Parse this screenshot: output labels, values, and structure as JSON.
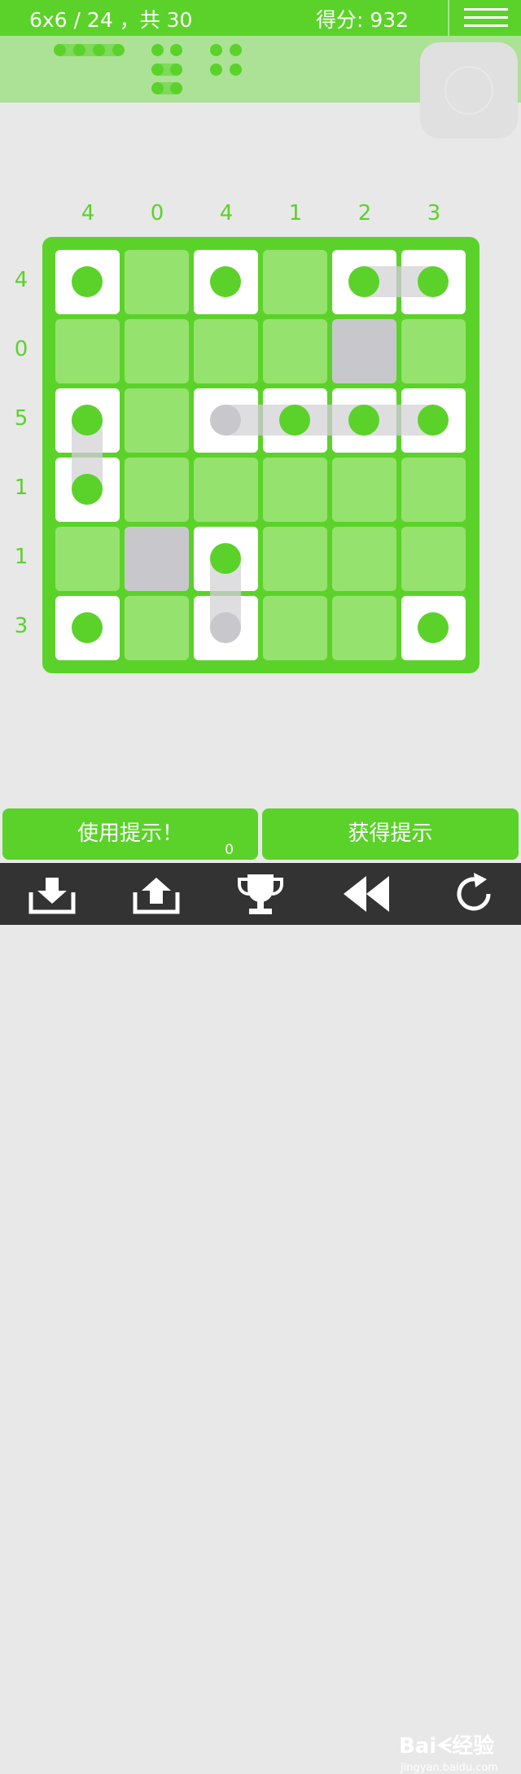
{
  "header": {
    "level_progress": "6x6 / 24 ，共 30",
    "score": "得分: 932",
    "menu_icon": "hamburger-menu-icon"
  },
  "pieces": {
    "items": [
      "ship-4",
      "ship-3",
      "ship-2",
      "ship-2"
    ]
  },
  "board": {
    "size": 6,
    "column_counts": [
      "4",
      "0",
      "4",
      "1",
      "2",
      "3"
    ],
    "row_counts": [
      "4",
      "0",
      "5",
      "1",
      "1",
      "3"
    ],
    "cells": [
      [
        "ship-single",
        "empty",
        "ship-single",
        "empty",
        "ship-h-left",
        "ship-h-right"
      ],
      [
        "empty",
        "empty",
        "empty",
        "empty",
        "blocked",
        "empty"
      ],
      [
        "ship-v-top",
        "empty",
        "ship-h-left-gray",
        "ship-h-mid",
        "ship-h-mid",
        "ship-h-right"
      ],
      [
        "ship-v-bottom",
        "empty",
        "empty",
        "empty",
        "empty",
        "empty"
      ],
      [
        "empty",
        "blocked",
        "ship-v-top",
        "empty",
        "empty",
        "empty"
      ],
      [
        "ship-single",
        "empty",
        "ship-v-bottom-gray",
        "empty",
        "empty",
        "ship-single"
      ]
    ]
  },
  "footer": {
    "use_hint_label": "使用提示！",
    "hint_count": "0",
    "get_hint_label": "获得提示"
  },
  "toolbar": {
    "icons": [
      "download-icon",
      "upload-icon",
      "trophy-icon",
      "rewind-icon",
      "refresh-icon"
    ]
  },
  "watermark": {
    "brand": "Baiᗕ经验",
    "url": "jingyan.baidu.com"
  },
  "colors": {
    "accent": "#5bd22a",
    "cell_empty": "#96e26f",
    "blocked": "#c8c8cc",
    "toolbar": "#333333"
  }
}
